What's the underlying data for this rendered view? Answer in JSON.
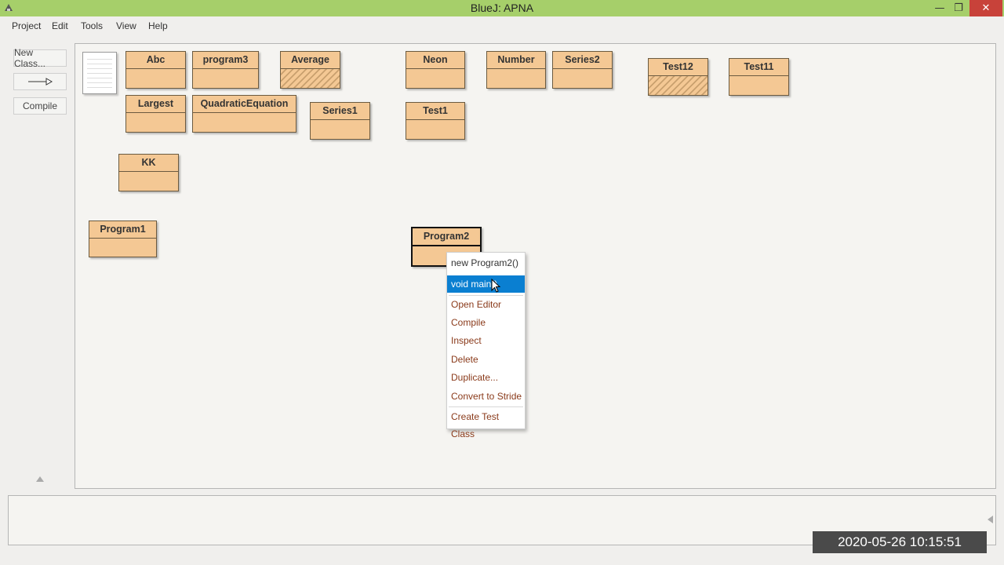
{
  "window": {
    "title": "BlueJ:  APNA"
  },
  "menu": [
    "Project",
    "Edit",
    "Tools",
    "View",
    "Help"
  ],
  "sidebar": {
    "new_class": "New Class...",
    "arrow": "—▷",
    "compile": "Compile"
  },
  "classes": [
    {
      "name": "Abc"
    },
    {
      "name": "program3"
    },
    {
      "name": "Average",
      "hatched": true
    },
    {
      "name": "Neon"
    },
    {
      "name": "Number"
    },
    {
      "name": "Series2"
    },
    {
      "name": "Test12",
      "hatched": true
    },
    {
      "name": "Test11"
    },
    {
      "name": "Largest"
    },
    {
      "name": "QuadraticEquation"
    },
    {
      "name": "Series1"
    },
    {
      "name": "Test1"
    },
    {
      "name": "KK"
    },
    {
      "name": "Program1"
    },
    {
      "name": "Program2",
      "selected": true
    }
  ],
  "context_menu": {
    "items": [
      "new Program2()",
      "void main()",
      "Open Editor",
      "Compile",
      "Inspect",
      "Delete",
      "Duplicate...",
      "Convert to Stride",
      "Create Test Class"
    ],
    "highlighted": "void main()"
  },
  "timestamp": "2020-05-26  10:15:51",
  "colors": {
    "titlebar": "#a6cf6a",
    "class_fill": "#f4c894",
    "highlight": "#0a7fd1"
  }
}
